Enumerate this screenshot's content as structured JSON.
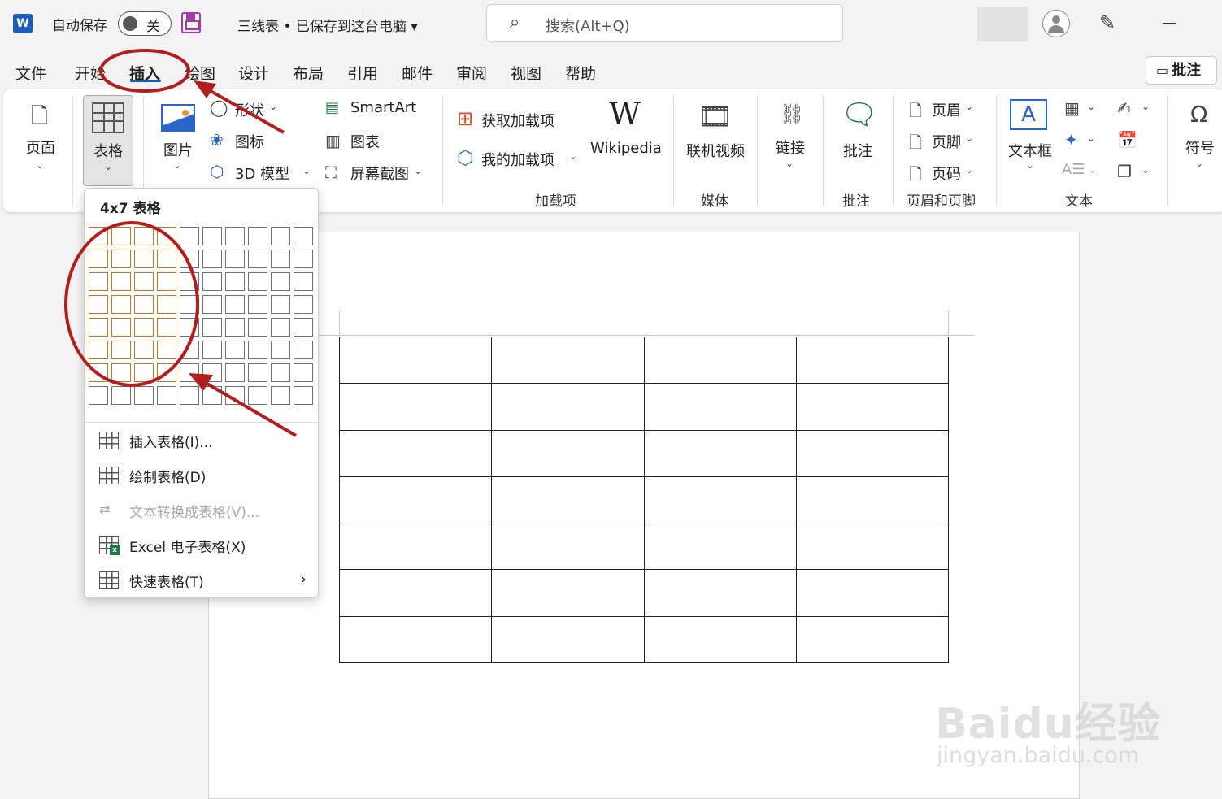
{
  "titlebar": {
    "app_icon": "W",
    "autosave_label": "自动保存",
    "autosave_state": "关",
    "doc_title": "三线表 • 已保存到这台电脑 ▾",
    "search_placeholder": "搜索(Alt+Q)"
  },
  "tabs": [
    {
      "label": "文件"
    },
    {
      "label": "开始"
    },
    {
      "label": "插入",
      "active": true
    },
    {
      "label": "绘图"
    },
    {
      "label": "设计"
    },
    {
      "label": "布局"
    },
    {
      "label": "引用"
    },
    {
      "label": "邮件"
    },
    {
      "label": "审阅"
    },
    {
      "label": "视图"
    },
    {
      "label": "帮助"
    }
  ],
  "comment_button": "批注",
  "ribbon": {
    "page": "页面",
    "table": "表格",
    "picture": "图片",
    "shapes": "形状",
    "icons": "图标",
    "model3d": "3D 模型",
    "smartart": "SmartArt",
    "chart": "图表",
    "screenshot": "屏幕截图",
    "get_addins": "获取加载项",
    "my_addins": "我的加载项",
    "wikipedia": "Wikipedia",
    "online_video": "联机视频",
    "link": "链接",
    "comment": "批注",
    "header": "页眉",
    "footer": "页脚",
    "page_number": "页码",
    "textbox": "文本框",
    "symbol": "符号",
    "groups": {
      "addins": "加载项",
      "media": "媒体",
      "comments": "批注",
      "header_footer": "页眉和页脚",
      "text": "文本"
    }
  },
  "table_dropdown": {
    "title": "4x7 表格",
    "grid_cols": 10,
    "grid_rows": 8,
    "selected_cols": 4,
    "selected_rows": 7,
    "items": [
      {
        "label": "插入表格(I)...",
        "enabled": true
      },
      {
        "label": "绘制表格(D)",
        "enabled": true
      },
      {
        "label": "文本转换成表格(V)...",
        "enabled": false
      },
      {
        "label": "Excel 电子表格(X)",
        "enabled": true
      },
      {
        "label": "快速表格(T)",
        "enabled": true,
        "submenu": true
      }
    ]
  },
  "document": {
    "table_rows": 7,
    "table_cols": 4
  },
  "watermark": {
    "brand": "Baidu经验",
    "url": "jingyan.baidu.com"
  },
  "colors": {
    "accent": "#1c5bb8",
    "annotation": "#b01e1e",
    "selection": "#c07628"
  }
}
